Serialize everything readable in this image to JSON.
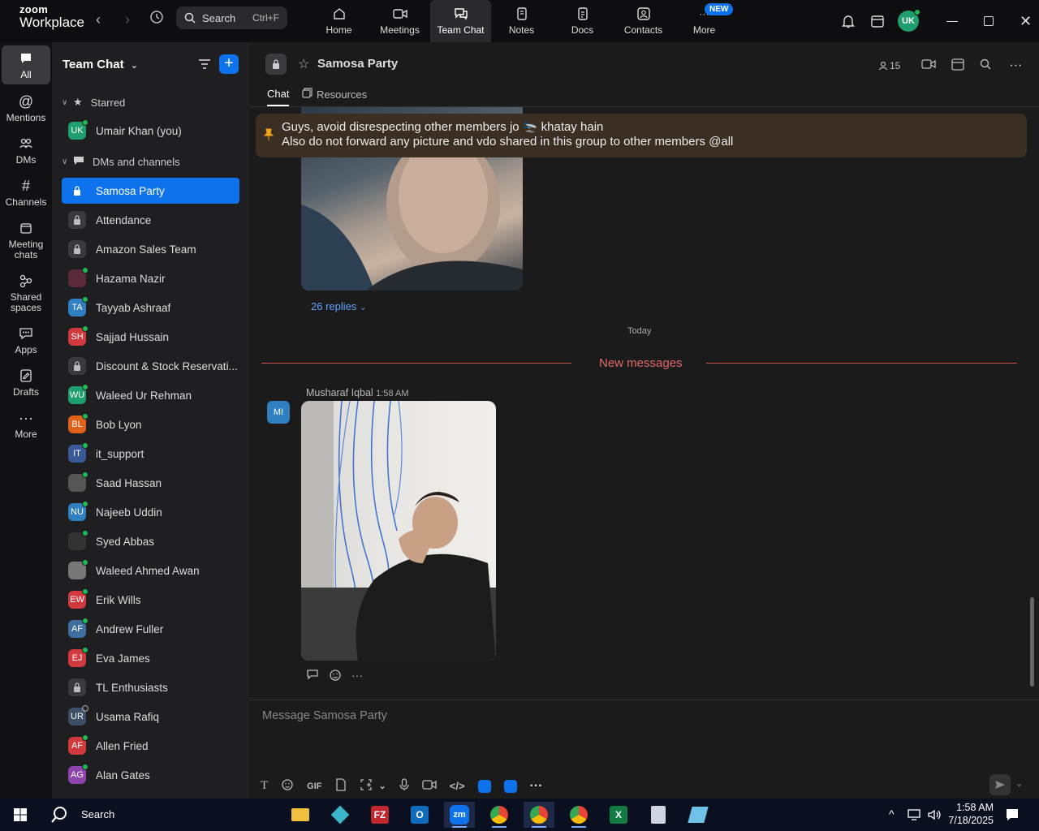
{
  "app": {
    "brand_top": "zoom",
    "brand_bottom": "Workplace"
  },
  "search": {
    "label": "Search",
    "shortcut": "Ctrl+F"
  },
  "tabs": [
    {
      "label": "Home",
      "icon": "home-icon"
    },
    {
      "label": "Meetings",
      "icon": "camera-icon"
    },
    {
      "label": "Team Chat",
      "icon": "chat-icon",
      "active": true
    },
    {
      "label": "Notes",
      "icon": "notes-icon"
    },
    {
      "label": "Docs",
      "icon": "docs-icon"
    },
    {
      "label": "Contacts",
      "icon": "contacts-icon"
    },
    {
      "label": "More",
      "icon": "more-icon",
      "badge": "NEW"
    }
  ],
  "user": {
    "initials": "UK"
  },
  "rail": [
    {
      "label": "All"
    },
    {
      "label": "Mentions"
    },
    {
      "label": "DMs"
    },
    {
      "label": "Channels"
    },
    {
      "label": "Meeting chats"
    },
    {
      "label": "Shared spaces"
    },
    {
      "label": "Apps"
    },
    {
      "label": "Drafts"
    },
    {
      "label": "More"
    }
  ],
  "sidebar": {
    "title": "Team Chat",
    "starred_label": "Starred",
    "dms_label": "DMs and channels",
    "starred": [
      {
        "name": "Umair Khan (you)",
        "initials": "UK",
        "color": "#1f9e6e"
      }
    ],
    "items": [
      {
        "name": "Samosa Party",
        "type": "lock",
        "selected": true
      },
      {
        "name": "Attendance",
        "type": "lock"
      },
      {
        "name": "Amazon Sales Team",
        "type": "lock"
      },
      {
        "name": "Hazama Nazir",
        "initials": "",
        "color": "#5a2a3a"
      },
      {
        "name": "Tayyab Ashraaf",
        "initials": "TA",
        "color": "#2f7fc1"
      },
      {
        "name": "Sajjad Hussain",
        "initials": "SH",
        "color": "#d0393e"
      },
      {
        "name": "Discount & Stock Reservati...",
        "type": "lock"
      },
      {
        "name": "Waleed Ur Rehman",
        "initials": "WU",
        "color": "#1f9e6e"
      },
      {
        "name": "Bob Lyon",
        "initials": "BL",
        "color": "#e0611a"
      },
      {
        "name": "it_support",
        "initials": "IT",
        "color": "#3b5998"
      },
      {
        "name": "Saad Hassan",
        "initials": "",
        "color": "#555"
      },
      {
        "name": "Najeeb Uddin",
        "initials": "NU",
        "color": "#2f7fc1"
      },
      {
        "name": "Syed Abbas",
        "initials": "",
        "color": "#333"
      },
      {
        "name": "Waleed Ahmed Awan",
        "initials": "",
        "color": "#777"
      },
      {
        "name": "Erik Wills",
        "initials": "EW",
        "color": "#d0393e"
      },
      {
        "name": "Andrew Fuller",
        "initials": "AF",
        "color": "#3d6e9e"
      },
      {
        "name": "Eva James",
        "initials": "EJ",
        "color": "#d0393e"
      },
      {
        "name": "TL Enthusiasts",
        "type": "lock"
      },
      {
        "name": "Usama Rafiq",
        "initials": "UR",
        "color": "#3d4e66"
      },
      {
        "name": "Allen Fried",
        "initials": "AF",
        "color": "#d0393e"
      },
      {
        "name": "Alan Gates",
        "initials": "AG",
        "color": "#8e44ad"
      }
    ]
  },
  "channel": {
    "name": "Samosa Party",
    "member_count": "15",
    "tab_chat": "Chat",
    "tab_resources": "Resources",
    "pinned_line1": "Guys, avoid disrespecting other members jo 🛬 khatay hain",
    "pinned_line2": "Also do not forward any picture and vdo shared in this group to other members @all",
    "replies": "26 replies",
    "date_sep": "Today",
    "new_messages": "New messages",
    "message": {
      "sender": "Musharaf Iqbal",
      "time": "1:58 AM",
      "initials": "MI"
    },
    "composer_placeholder": "Message Samosa Party",
    "toolbar_gif": "GIF"
  },
  "taskbar": {
    "search_label": "Search",
    "time": "1:58 AM",
    "date": "7/18/2025"
  }
}
